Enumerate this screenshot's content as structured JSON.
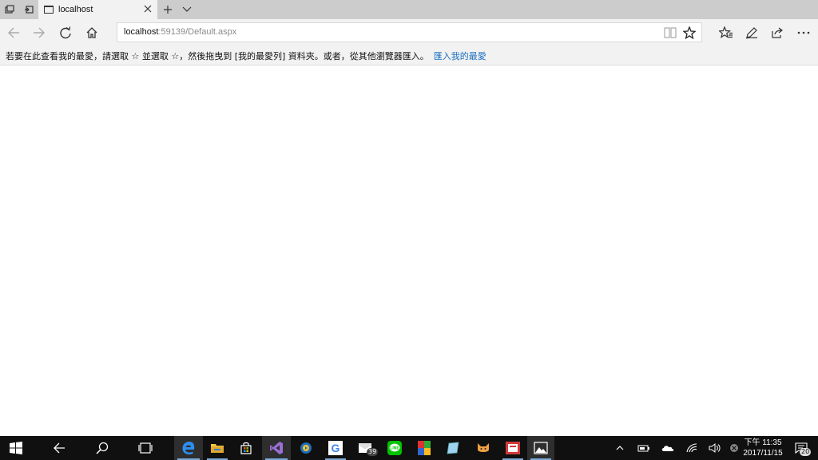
{
  "tab": {
    "title": "localhost"
  },
  "address": {
    "host": "localhost",
    "rest": ":59139/Default.aspx"
  },
  "favorites_bar": {
    "message": "若要在此查看我的最愛，請選取 ☆ 並選取 ☆，然後拖曳到 [我的最愛列] 資料夾。或者，從其他瀏覽器匯入。",
    "import_link": "匯入我的最愛"
  },
  "clock": {
    "time": "下午 11:35",
    "date": "2017/11/15"
  },
  "taskbar": {
    "mail_badge": "39",
    "notification_count": "20"
  },
  "colors": {
    "accent": "#1a6fc0",
    "taskbar": "#101010",
    "chrome": "#f2f2f2"
  }
}
